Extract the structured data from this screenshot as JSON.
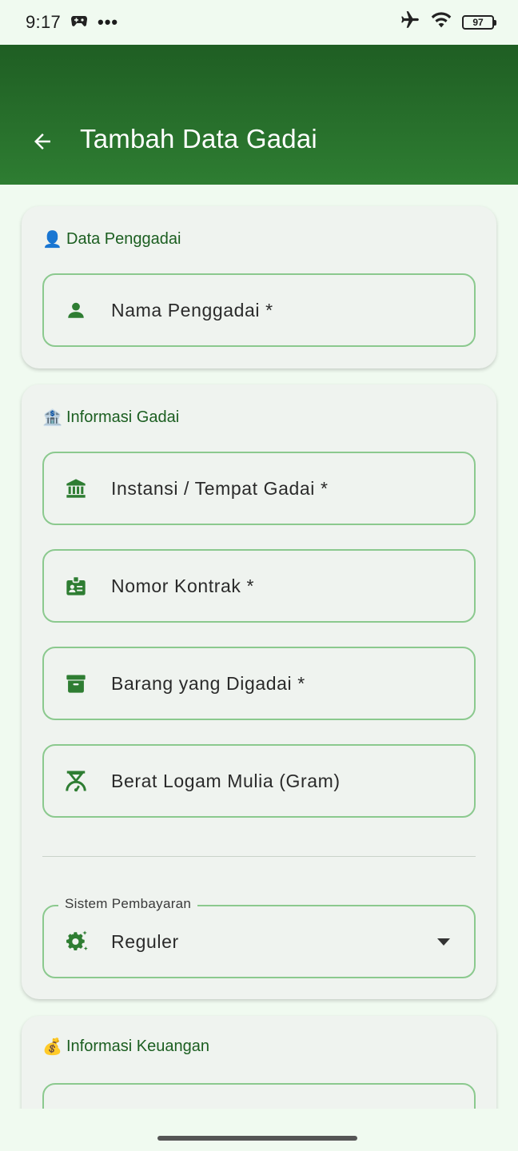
{
  "status_bar": {
    "time": "9:17",
    "more": "•••",
    "battery": "97"
  },
  "app_bar": {
    "title": "Tambah Data Gadai"
  },
  "section_penggadai": {
    "icon": "👤",
    "title": "Data Penggadai",
    "fields": [
      {
        "label": "Nama Penggadai *",
        "icon": "person-icon"
      }
    ]
  },
  "section_gadai": {
    "icon": "🏦",
    "title": "Informasi Gadai",
    "fields": [
      {
        "label": "Instansi / Tempat Gadai *",
        "icon": "bank-icon"
      },
      {
        "label": "Nomor Kontrak *",
        "icon": "badge-icon"
      },
      {
        "label": "Barang yang Digadai *",
        "icon": "archive-icon"
      },
      {
        "label": "Berat Logam Mulia (Gram)",
        "icon": "scale-icon"
      }
    ],
    "payment_system": {
      "label": "Sistem Pembayaran",
      "value": "Reguler",
      "icon": "settings-icon"
    }
  },
  "section_keuangan": {
    "icon": "💰",
    "title": "Informasi Keuangan"
  },
  "colors": {
    "primary": "#2e7d32",
    "primary_dark": "#1f5e23",
    "field_border": "#8bc98e",
    "background": "#f0faf0"
  }
}
